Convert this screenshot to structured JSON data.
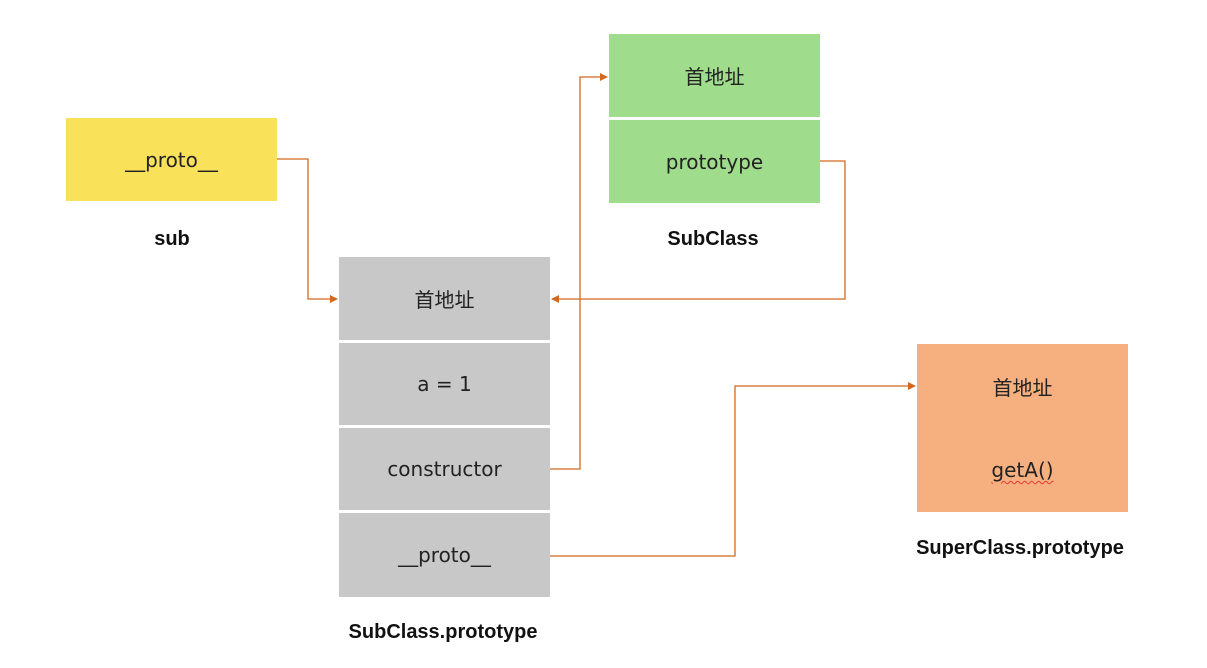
{
  "colors": {
    "sub": "#f9e15a",
    "subclass": "#9fdc8b",
    "subclass_prototype": "#c8c8c8",
    "superclass_prototype": "#f6b07f",
    "arrow": "#d2691e"
  },
  "sub": {
    "fields": [
      "__proto__"
    ],
    "caption": "sub"
  },
  "subclass": {
    "fields": [
      "首地址",
      "prototype"
    ],
    "caption": "SubClass"
  },
  "subclass_prototype": {
    "fields": [
      "首地址",
      "a = 1",
      "constructor",
      "__proto__"
    ],
    "caption": "SubClass.prototype"
  },
  "superclass_prototype": {
    "fields": [
      "首地址",
      "getA()"
    ],
    "caption": "SuperClass.prototype"
  }
}
